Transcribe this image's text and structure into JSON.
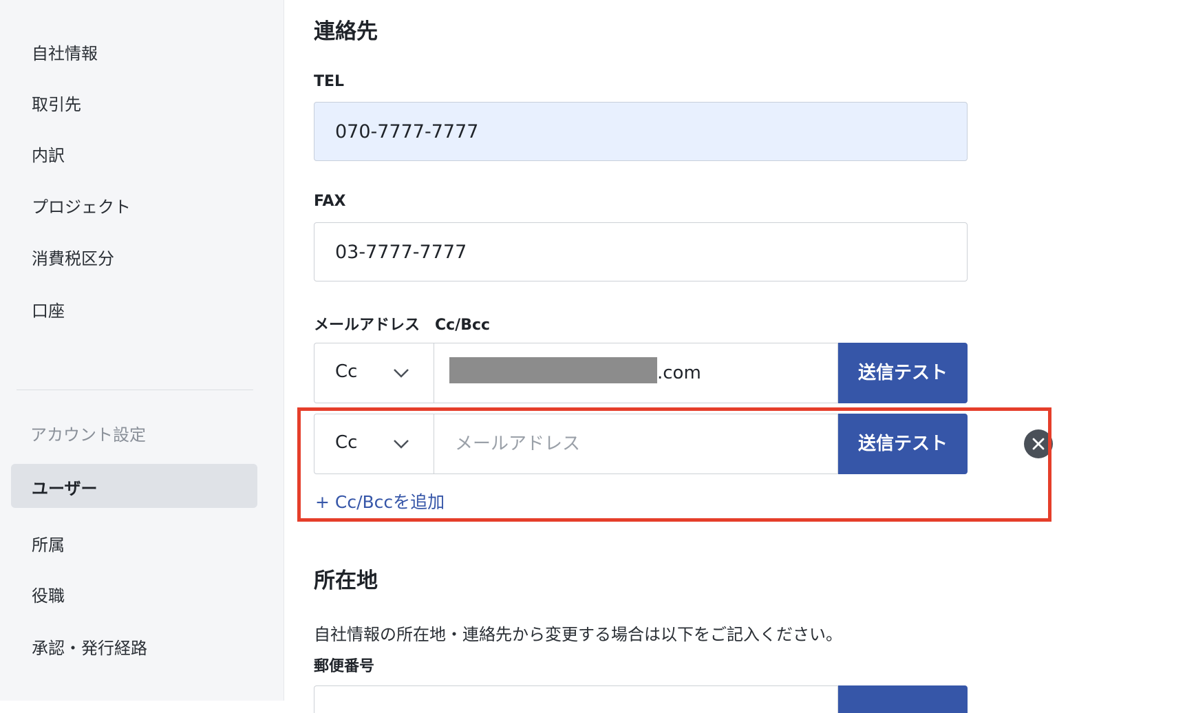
{
  "sidebar": {
    "items": [
      "自社情報",
      "取引先",
      "内訳",
      "プロジェクト",
      "消費税区分",
      "口座"
    ],
    "section_title": "アカウント設定",
    "active_item": "ユーザー",
    "sub_items": [
      "所属",
      "役職",
      "承認・発行経路"
    ]
  },
  "contact": {
    "title": "連絡先",
    "tel_label": "TEL",
    "tel_value": "070-7777-7777",
    "fax_label": "FAX",
    "fax_value": "03-7777-7777",
    "email_label": "メールアドレス　Cc/Bcc",
    "rows": [
      {
        "type": "Cc",
        "email_suffix": ".com",
        "send_label": "送信テスト"
      },
      {
        "type": "Cc",
        "placeholder": "メールアドレス",
        "send_label": "送信テスト"
      }
    ],
    "add_link": "+ Cc/Bccを追加"
  },
  "address": {
    "title": "所在地",
    "description": "自社情報の所在地・連絡先から変更する場合は以下をご記入ください。",
    "zip_label": "郵便番号"
  },
  "colors": {
    "primary": "#3656a8",
    "highlight": "#e53e2a",
    "sidebar_bg": "#f5f6f8",
    "autofill_bg": "#e8f0fe"
  }
}
